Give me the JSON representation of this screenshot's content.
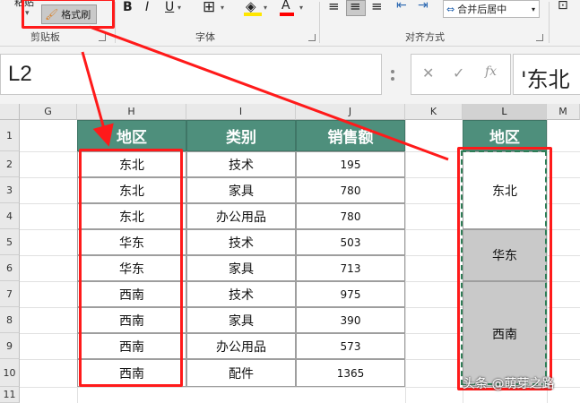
{
  "ribbon": {
    "clipboard": {
      "cut_label": "粘贴",
      "format_painter_label": "格式刷",
      "group_label": "剪贴板"
    },
    "font": {
      "bold": "B",
      "underline": "U",
      "group_label": "字体"
    },
    "align": {
      "merge_label": "合并后居中",
      "group_label": "对齐方式"
    }
  },
  "name_box": {
    "value": "L2"
  },
  "formula_bar": {
    "value": "'东北"
  },
  "columns": [
    "G",
    "H",
    "I",
    "J",
    "K",
    "L",
    "M"
  ],
  "rows": [
    "1",
    "2",
    "3",
    "4",
    "5",
    "6",
    "7",
    "8",
    "9",
    "10",
    "11"
  ],
  "table": {
    "headers": [
      "地区",
      "类别",
      "销售额"
    ],
    "rows": [
      [
        "东北",
        "技术",
        "195"
      ],
      [
        "东北",
        "家具",
        "780"
      ],
      [
        "东北",
        "办公用品",
        "780"
      ],
      [
        "华东",
        "技术",
        "503"
      ],
      [
        "华东",
        "家具",
        "713"
      ],
      [
        "西南",
        "技术",
        "975"
      ],
      [
        "西南",
        "家具",
        "390"
      ],
      [
        "西南",
        "办公用品",
        "573"
      ],
      [
        "西南",
        "配件",
        "1365"
      ]
    ]
  },
  "merged_column": {
    "header": "地区",
    "groups": [
      "东北",
      "华东",
      "西南"
    ]
  },
  "colors": {
    "header_fill": "#4e8f7c",
    "annotation_red": "#ff1a1a",
    "merged_fill": "#c9c9c9"
  },
  "watermark": "头条 @萌芽之路"
}
